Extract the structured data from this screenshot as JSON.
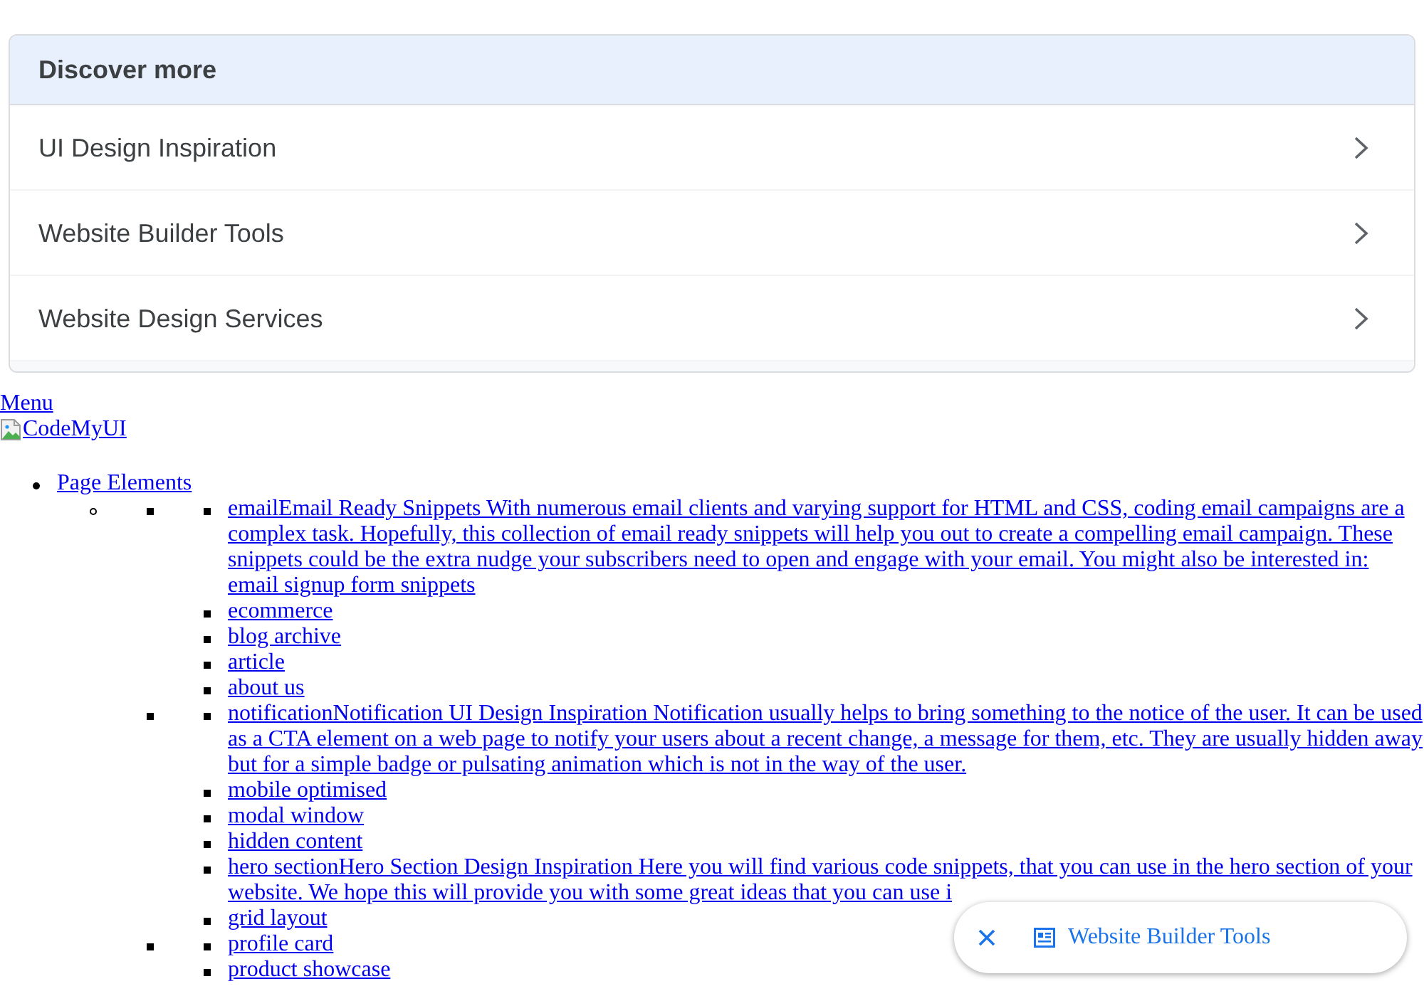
{
  "discover_more": {
    "title": "Discover more",
    "items": [
      {
        "label": "UI Design Inspiration"
      },
      {
        "label": "Website Builder Tools"
      },
      {
        "label": "Website Design Services"
      }
    ]
  },
  "page": {
    "menu_link": "Menu",
    "logo_alt": "CodeMyUI",
    "nav": [
      {
        "label": "Page Elements",
        "children": [
          {
            "children": [
              {
                "children": [
                  {
                    "label": "emailEmail Ready Snippets With numerous email clients and varying support for HTML and CSS, coding email campaigns are a complex task. Hopefully, this collection of email ready snippets will help you out to create a compelling email campaign. These snippets could be the extra nudge your subscribers need to open and engage with your email. You might also be interested in: email signup form snippets"
                  },
                  {
                    "label": "ecommerce"
                  },
                  {
                    "label": "blog archive"
                  },
                  {
                    "label": "article"
                  },
                  {
                    "label": "about us"
                  }
                ]
              },
              {
                "children": [
                  {
                    "label": "notificationNotification UI Design Inspiration Notification usually helps to bring something to the notice of the user. It can be used as a CTA element on a web page to notify your users about a recent change, a message for them, etc. They are usually hidden away but for a simple badge or pulsating animation which is not in the way of the user."
                  },
                  {
                    "label": "mobile optimised"
                  },
                  {
                    "label": "modal window"
                  },
                  {
                    "label": "hidden content"
                  },
                  {
                    "label": "hero sectionHero Section Design Inspiration Here you will find various code snippets, that you can use in the hero section of your website. We hope this will provide you with some great ideas that you can use i"
                  },
                  {
                    "label": "grid layout"
                  }
                ]
              },
              {
                "children": [
                  {
                    "label": "profile card"
                  },
                  {
                    "label": "product showcase"
                  }
                ]
              }
            ]
          }
        ]
      }
    ]
  },
  "suggestion_chip": {
    "label": "Website Builder Tools"
  }
}
